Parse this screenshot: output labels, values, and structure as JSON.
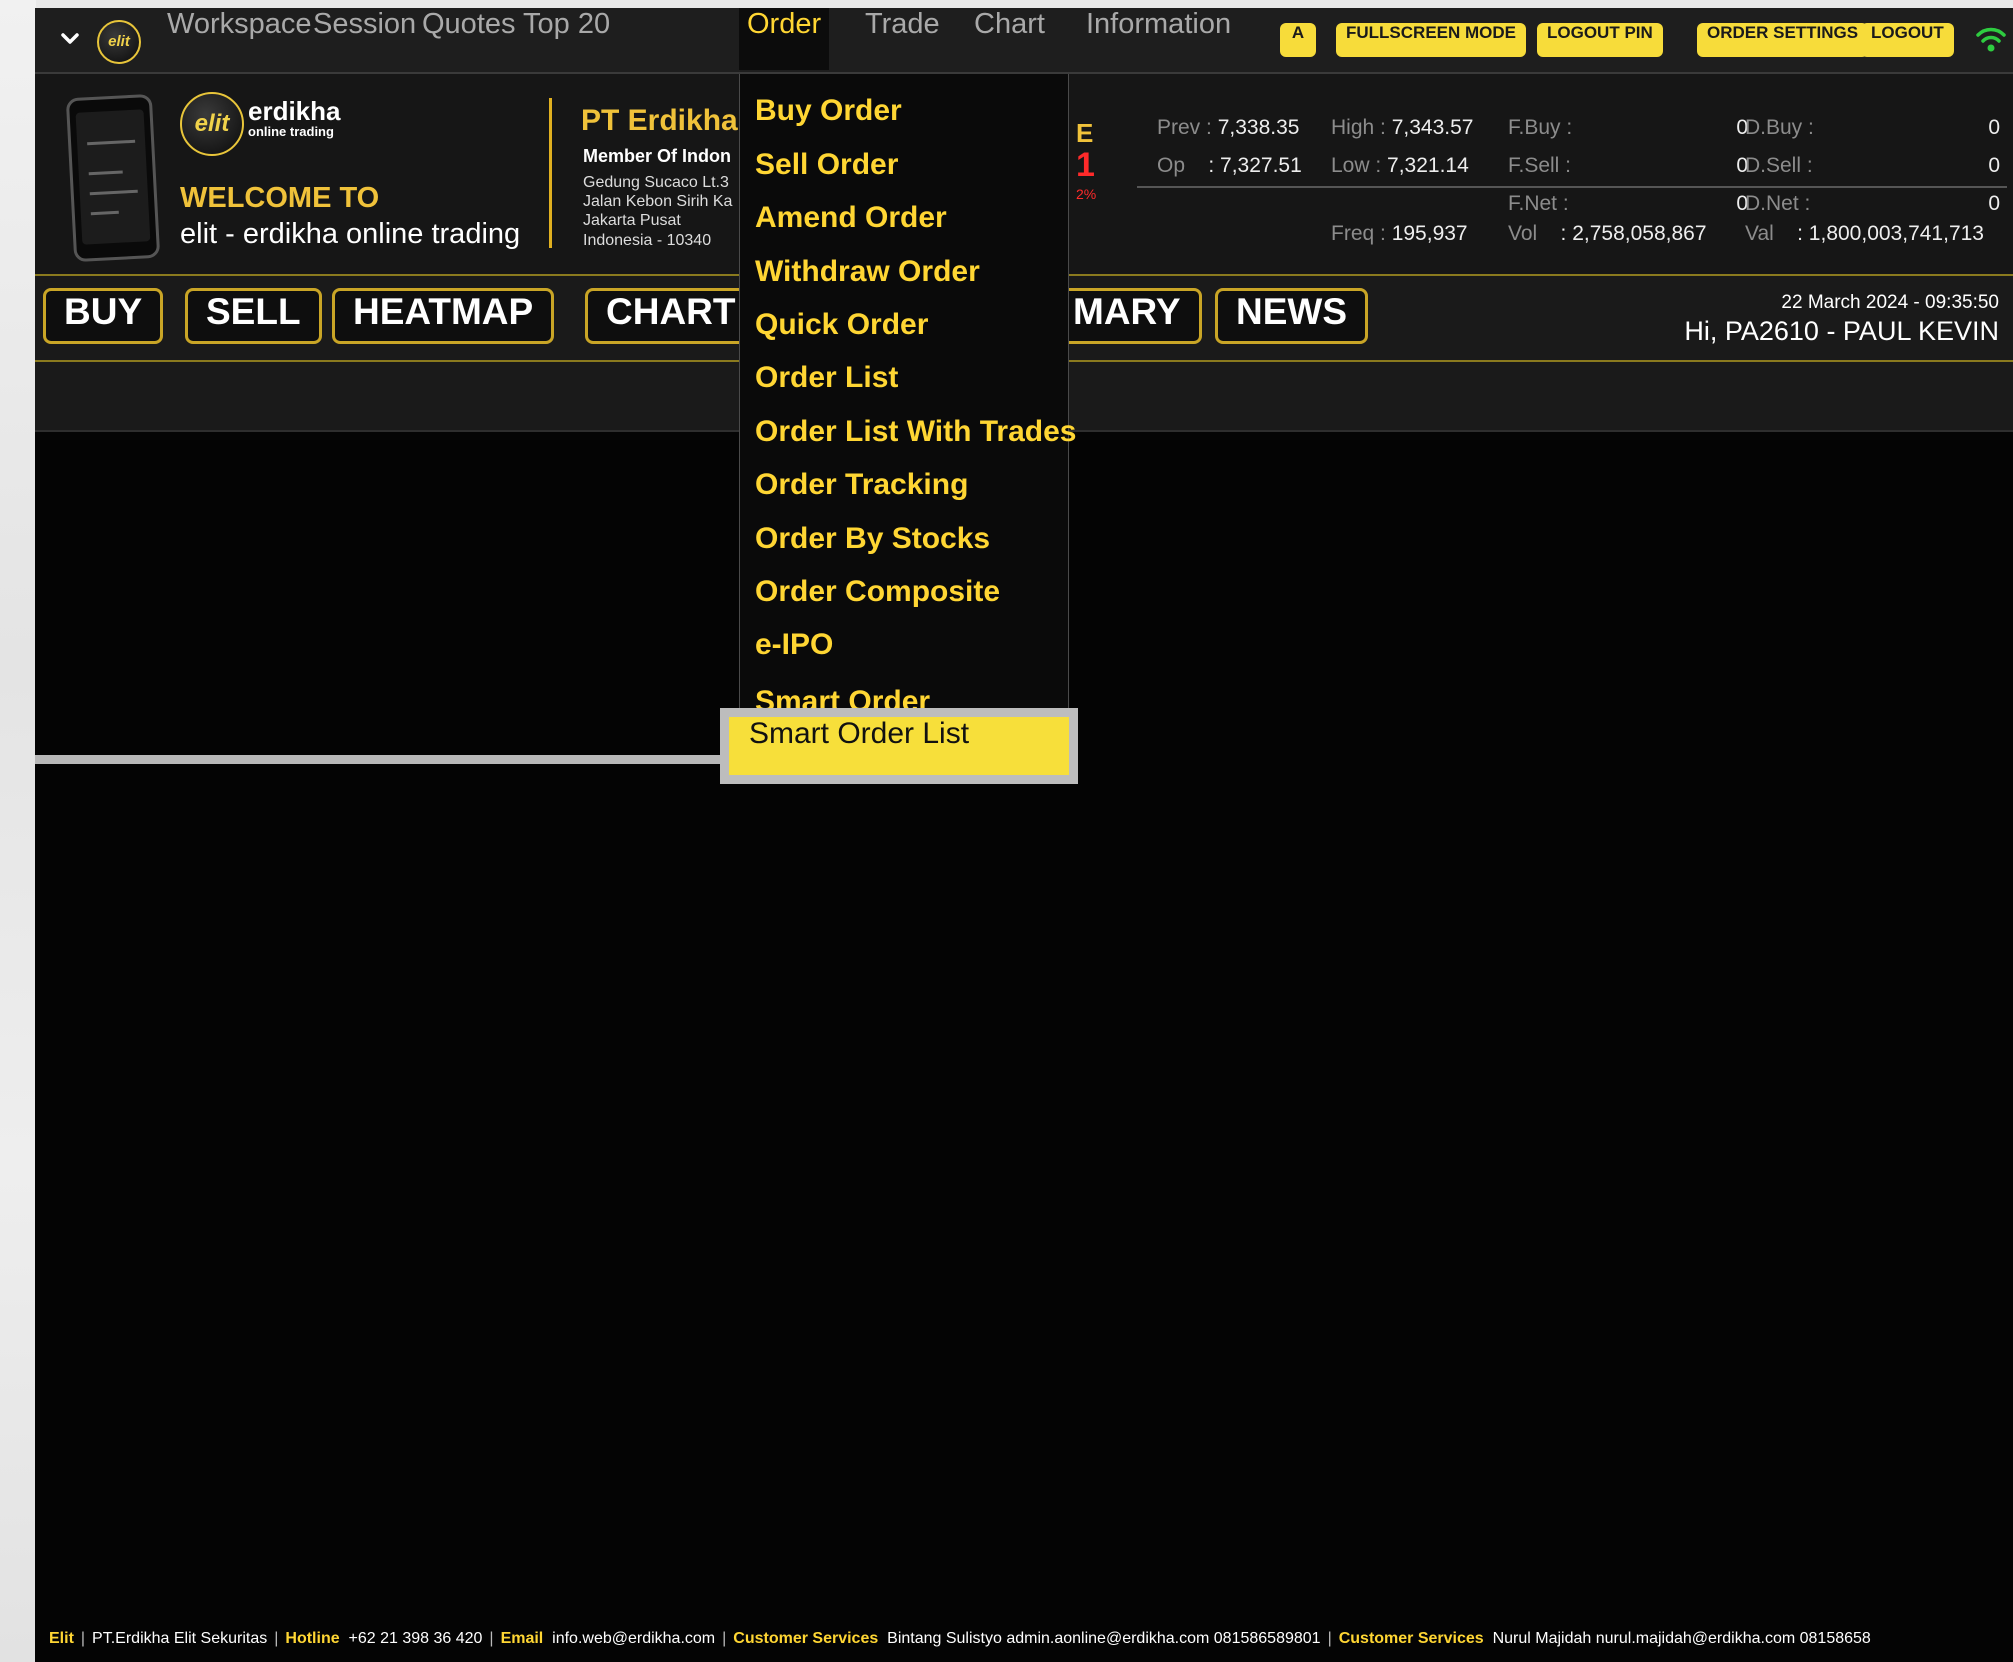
{
  "menubar": {
    "items": [
      "Workspace",
      "Session",
      "Quotes",
      "Top 20",
      "Order",
      "Trade",
      "Chart",
      "Information"
    ],
    "active": "Order",
    "font_size_button": "A",
    "buttons": [
      "FULLSCREEN MODE",
      "LOGOUT PIN",
      "ORDER SETTINGS",
      "LOGOUT"
    ],
    "logo_text": "elit"
  },
  "header": {
    "brand_name": "erdikha",
    "brand_tagline": "online trading",
    "welcome": "WELCOME TO",
    "welcome_sub": "elit - erdikha online trading",
    "company_name": "PT Erdikha I",
    "company_lines": [
      "Member Of Indon",
      "Gedung Sucaco Lt.3",
      "Jalan Kebon Sirih Ka",
      "Jakarta Pusat",
      "Indonesia - 10340"
    ],
    "index_letter": "E",
    "index_value_fragment": "1",
    "index_pct_fragment": "2%",
    "stats": {
      "prev_label": "Prev :",
      "prev": "7,338.35",
      "high_label": "High :",
      "high": "7,343.57",
      "op_label": "Op",
      "op": ": 7,327.51",
      "low_label": "Low :",
      "low": "7,321.14",
      "fbuy_label": "F.Buy :",
      "fbuy": "0",
      "fsell_label": "F.Sell :",
      "fsell": "0",
      "fnet_label": "F.Net :",
      "fnet": "0",
      "dbuy_label": "D.Buy :",
      "dbuy": "0",
      "dsell_label": "D.Sell :",
      "dsell": "0",
      "dnet_label": "D.Net :",
      "dnet": "0",
      "freq_label": "Freq :",
      "freq": "195,937",
      "vol_label": "Vol",
      "vol": ": 2,758,058,867",
      "val_label": "Val",
      "val": ": 1,800,003,741,713"
    }
  },
  "quickbar": {
    "buttons": [
      "BUY",
      "SELL",
      "HEATMAP",
      "CHART",
      "MARY",
      "NEWS"
    ],
    "datetime": "22 March 2024 - 09:35:50",
    "greeting": "Hi, PA2610 - PAUL KEVIN"
  },
  "order_menu": {
    "items": [
      "Buy Order",
      "Sell Order",
      "Amend Order",
      "Withdraw Order",
      "Quick Order",
      "Order List",
      "Order List With Trades",
      "Order Tracking",
      "Order By Stocks",
      "Order Composite",
      "e-IPO",
      "Smart Order"
    ],
    "highlighted": "Smart Order List"
  },
  "footer": {
    "app": "Elit",
    "company": "PT.Erdikha Elit Sekuritas",
    "hotline_label": "Hotline",
    "hotline": "+62 21 398 36 420",
    "email_label": "Email",
    "email": "info.web@erdikha.com",
    "cs1_label": "Customer Services",
    "cs1": "Bintang Sulistyo  admin.aonline@erdikha.com  081586589801",
    "cs2_label": "Customer Services",
    "cs2": "Nurul Majidah  nurul.majidah@erdikha.com  08158658"
  },
  "colors": {
    "accent_yellow": "#ffd633",
    "button_yellow": "#f7dc3a",
    "gold_border": "#c9a526",
    "negative_red": "#ff2a2a",
    "background": "#040404",
    "wifi_green": "#2ecc40"
  }
}
